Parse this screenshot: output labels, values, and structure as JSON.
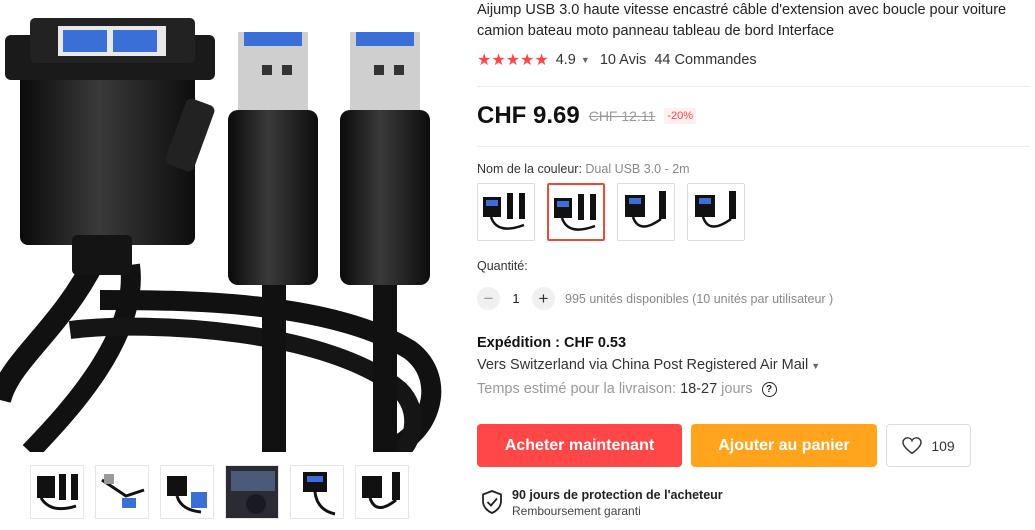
{
  "product": {
    "title": "Aijump USB 3.0 haute vitesse encastré câble d'extension avec boucle pour voiture camion bateau moto panneau tableau de bord Interface",
    "stars": "★★★★★",
    "rating": "4.9",
    "reviews": "10 Avis",
    "orders": "44 Commandes"
  },
  "price": {
    "current": "CHF 9.69",
    "original": "CHF 12.11",
    "discount": "-20%"
  },
  "color": {
    "label": "Nom de la couleur: ",
    "value": "Dual USB 3.0 - 2m",
    "options": [
      "Dual USB 3.0 - 1m",
      "Dual USB 3.0 - 2m",
      "Single USB 3.0 - 1m",
      "Single USB 3.0 - 2m"
    ],
    "selected_index": 1
  },
  "quantity": {
    "label": "Quantité:",
    "minus": "−",
    "plus": "+",
    "value": "1",
    "available": "995 unités disponibles (10 unités par utilisateur )"
  },
  "shipping": {
    "title": "Expédition : CHF 0.53",
    "route": "Vers Switzerland via China Post Registered Air Mail",
    "estimate_label": "Temps estimé pour la livraison:",
    "estimate_value": "18-27",
    "estimate_unit": "jours",
    "help": "?"
  },
  "actions": {
    "buy": "Acheter maintenant",
    "cart": "Ajouter au panier",
    "wishlist_count": "109"
  },
  "protection": {
    "title": "90 jours de protection de l'acheteur",
    "subtitle": "Remboursement garanti"
  },
  "colors": {
    "accent": "#ff4747",
    "cart": "#ffa41c",
    "usb_blue": "#3a6fd8"
  }
}
